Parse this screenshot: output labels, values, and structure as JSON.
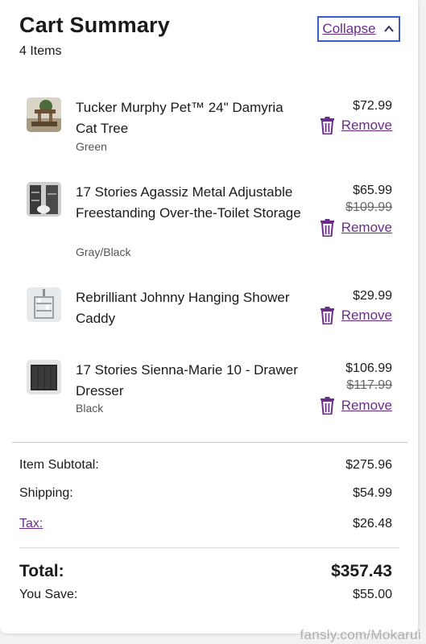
{
  "header": {
    "title": "Cart Summary",
    "item_count": "4 Items",
    "collapse_label": "Collapse"
  },
  "items": [
    {
      "name": "Tucker Murphy Pet™ 24\" Damyria Cat Tree",
      "variant": "Green",
      "price": "$72.99",
      "old_price": "",
      "remove_label": "Remove",
      "thumb_icon": "cat-tree-thumbnail"
    },
    {
      "name": "17 Stories Agassiz Metal Adjustable Freestanding Over-the-Toilet Storage",
      "variant": "Gray/Black",
      "price": "$65.99",
      "old_price": "$109.99",
      "remove_label": "Remove",
      "thumb_icon": "toilet-storage-thumbnail"
    },
    {
      "name": "Rebrilliant Johnny Hanging Shower Caddy",
      "variant": "",
      "price": "$29.99",
      "old_price": "",
      "remove_label": "Remove",
      "thumb_icon": "shower-caddy-thumbnail"
    },
    {
      "name": "17 Stories Sienna-Marie 10 - Drawer Dresser",
      "variant": "Black",
      "price": "$106.99",
      "old_price": "$117.99",
      "remove_label": "Remove",
      "thumb_icon": "dresser-thumbnail"
    }
  ],
  "summary": {
    "subtotal_label": "Item Subtotal:",
    "subtotal_value": "$275.96",
    "shipping_label": "Shipping:",
    "shipping_value": "$54.99",
    "tax_label": "Tax:",
    "tax_value": "$26.48",
    "total_label": "Total:",
    "total_value": "$357.43",
    "save_label": "You Save:",
    "save_value": "$55.00"
  },
  "watermark": "fansly.com/Mokarui",
  "colors": {
    "link": "#6b2d8a",
    "focus_border": "#3a5ccc"
  }
}
